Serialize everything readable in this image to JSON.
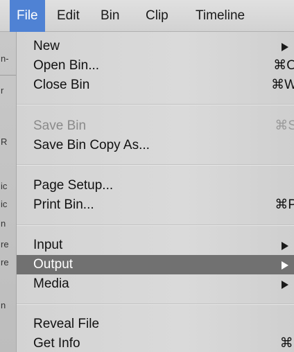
{
  "menubar": {
    "items": [
      {
        "label": "File"
      },
      {
        "label": "Edit"
      },
      {
        "label": "Bin"
      },
      {
        "label": "Clip"
      },
      {
        "label": "Timeline"
      }
    ],
    "active": "File"
  },
  "background_window": {
    "fragments": [
      "n-",
      "r",
      "R",
      "ic",
      "ic",
      "n",
      "re",
      "re",
      "n"
    ]
  },
  "file_menu": {
    "groups": [
      [
        {
          "label": "New",
          "submenu": true
        },
        {
          "label": "Open Bin...",
          "shortcut": "⌘O"
        },
        {
          "label": "Close Bin",
          "shortcut": "⌘W"
        }
      ],
      [
        {
          "label": "Save Bin",
          "shortcut": "⌘S",
          "disabled": true
        },
        {
          "label": "Save Bin Copy As..."
        }
      ],
      [
        {
          "label": "Page Setup..."
        },
        {
          "label": "Print Bin...",
          "shortcut": "⌘P"
        }
      ],
      [
        {
          "label": "Input",
          "submenu": true
        },
        {
          "label": "Output",
          "submenu": true,
          "highlighted": true
        },
        {
          "label": "Media",
          "submenu": true
        }
      ],
      [
        {
          "label": "Reveal File"
        },
        {
          "label": "Get Info",
          "shortcut": "⌘I"
        }
      ]
    ]
  },
  "colors": {
    "active_menu_bg": "#4f82d4",
    "highlight_bg": "#717171",
    "menu_bg": "#d6d6d6",
    "disabled_text": "#8a8a8a"
  }
}
